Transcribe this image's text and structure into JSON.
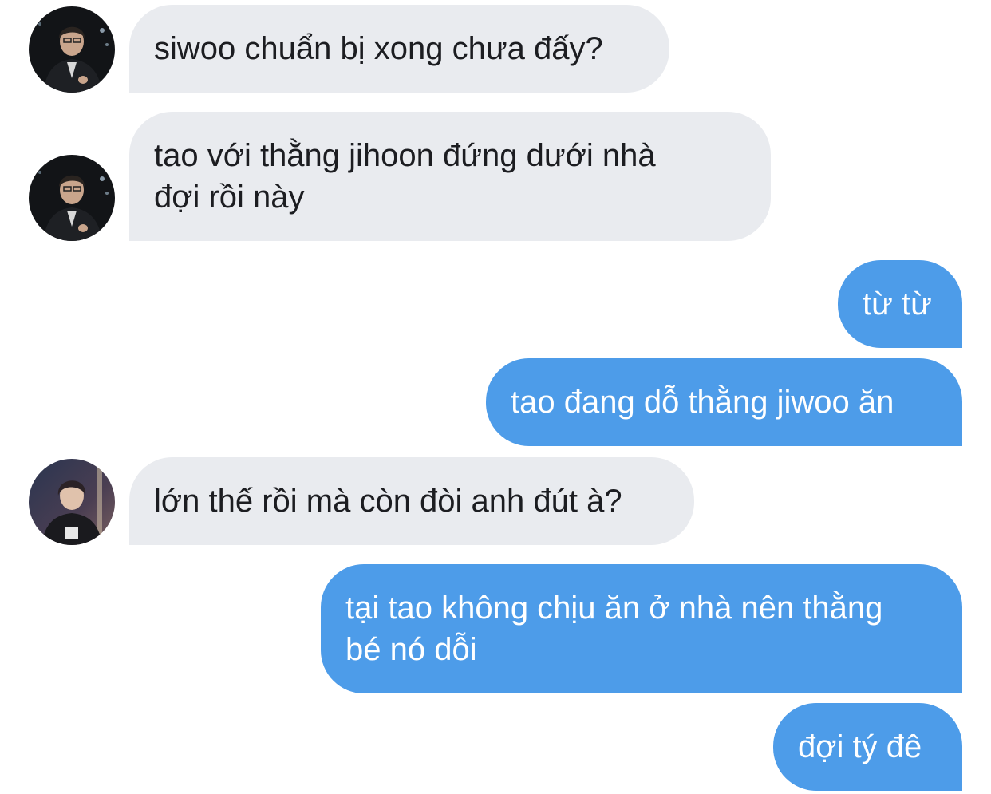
{
  "conversation": {
    "messages": [
      {
        "direction": "in",
        "avatar": "avatar-man-black-suit",
        "text": "siwoo chuẩn bị xong chưa đấy?"
      },
      {
        "direction": "in",
        "avatar": "avatar-man-black-suit",
        "text": "tao với thằng jihoon đứng dưới nhà\nđợi rồi này"
      },
      {
        "direction": "out",
        "text": "từ từ"
      },
      {
        "direction": "out",
        "text": "tao đang dỗ thằng jiwoo ăn"
      },
      {
        "direction": "in",
        "avatar": "avatar-player-jersey",
        "text": "lớn thế rồi mà còn đòi anh đút à?"
      },
      {
        "direction": "out",
        "text": "tại tao không chịu ăn ở nhà nên thằng\nbé nó dỗi"
      },
      {
        "direction": "out",
        "text": "đợi tý đê"
      }
    ]
  },
  "colors": {
    "background": "#ffffff",
    "incoming_bubble": "#e9ebef",
    "incoming_text": "#1c1d21",
    "outgoing_bubble": "#4d9ce9",
    "outgoing_text": "#ffffff"
  }
}
